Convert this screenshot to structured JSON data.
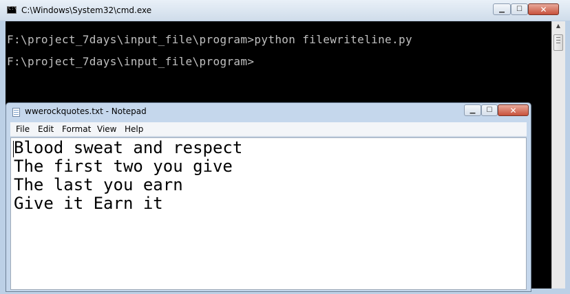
{
  "cmd": {
    "title": "C:\\Windows\\System32\\cmd.exe",
    "icon_label": "C:\\",
    "lines": [
      "F:\\project_7days\\input_file\\program>python filewriteline.py",
      "F:\\project_7days\\input_file\\program>"
    ]
  },
  "notepad": {
    "title": "wwerockquotes.txt - Notepad",
    "menu": [
      "File",
      "Edit",
      "Format",
      "View",
      "Help"
    ],
    "content": [
      "Blood sweat and respect",
      "The first two you give",
      "The last you earn",
      "Give it Earn it"
    ]
  },
  "icons": {
    "cmd": "console-icon",
    "notepad": "notepad-icon",
    "minimize": "minimize-icon",
    "maximize": "maximize-icon",
    "close": "close-icon",
    "scroll_up": "chevron-up-icon"
  },
  "colors": {
    "console_bg": "#000000",
    "console_text": "#c0c0c0",
    "close_button": "#c8523c",
    "titlebar": "#c5d7ec"
  }
}
